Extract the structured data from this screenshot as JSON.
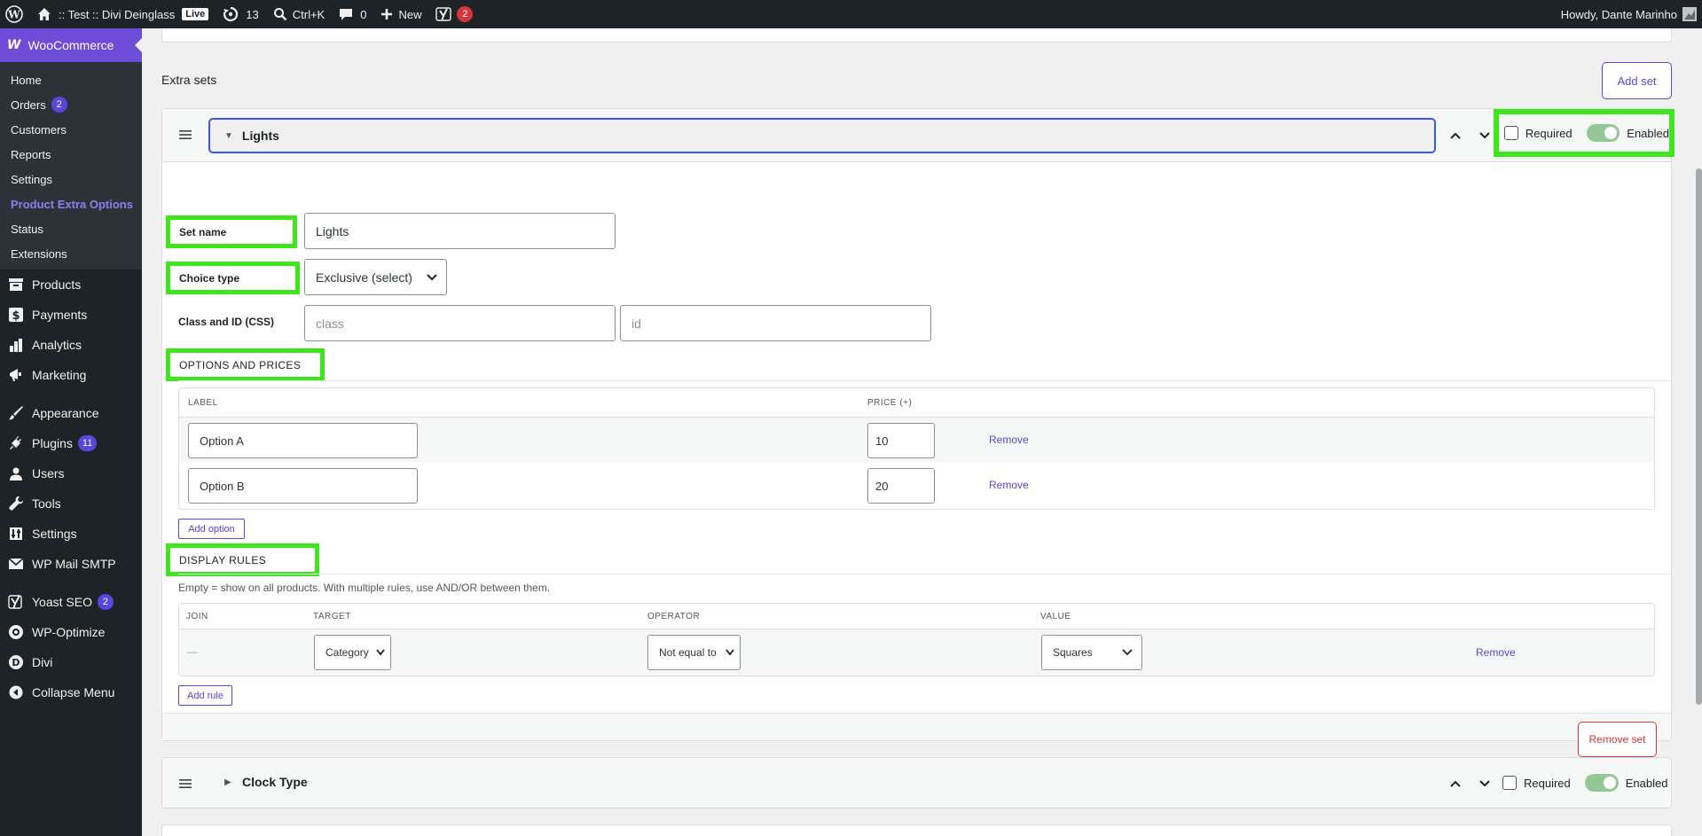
{
  "admin_bar": {
    "site_name": ":: Test :: Divi Deinglass",
    "live_badge": "Live",
    "updates_count": "13",
    "search_shortcut": "Ctrl+K",
    "comments_count": "0",
    "new_label": "New",
    "yoast_count": "2",
    "howdy": "Howdy, Dante Marinho"
  },
  "sidebar": {
    "woocommerce_label": "WooCommerce",
    "woo_submenu": [
      {
        "label": "Home"
      },
      {
        "label": "Orders",
        "count": "2"
      },
      {
        "label": "Customers"
      },
      {
        "label": "Reports"
      },
      {
        "label": "Settings"
      },
      {
        "label": "Product Extra Options"
      },
      {
        "label": "Status"
      },
      {
        "label": "Extensions"
      }
    ],
    "menu": {
      "products": "Products",
      "payments": "Payments",
      "analytics": "Analytics",
      "marketing": "Marketing",
      "appearance": "Appearance",
      "plugins": "Plugins",
      "plugins_count": "11",
      "users": "Users",
      "tools": "Tools",
      "settings": "Settings",
      "wp_mail_smtp": "WP Mail SMTP",
      "yoast_seo": "Yoast SEO",
      "yoast_count": "2",
      "wp_optimize": "WP-Optimize",
      "divi": "Divi",
      "collapse": "Collapse Menu"
    }
  },
  "main": {
    "extra_sets_title": "Extra sets",
    "add_set_label": "Add set",
    "set1": {
      "title": "Lights",
      "required_label": "Required",
      "enabled_label": "Enabled",
      "set_name_label": "Set name",
      "set_name_value": "Lights",
      "choice_type_label": "Choice type",
      "choice_type_value": "Exclusive (select)",
      "class_id_label": "Class and ID (CSS)",
      "class_placeholder": "class",
      "id_placeholder": "id",
      "options_heading": "OPTIONS AND PRICES",
      "col_label": "LABEL",
      "col_price": "PRICE (+)",
      "options": [
        {
          "label": "Option A",
          "price": "10",
          "remove": "Remove"
        },
        {
          "label": "Option B",
          "price": "20",
          "remove": "Remove"
        }
      ],
      "add_option_label": "Add option",
      "display_rules_heading": "DISPLAY RULES",
      "display_rules_help": "Empty = show on all products. With multiple rules, use AND/OR between them.",
      "rules_cols": {
        "join": "JOIN",
        "target": "TARGET",
        "operator": "OPERATOR",
        "value": "VALUE"
      },
      "rule": {
        "join": "—",
        "target": "Category",
        "operator": "Not equal to",
        "value": "Squares",
        "remove": "Remove"
      },
      "add_rule_label": "Add rule",
      "remove_set_label": "Remove set"
    },
    "set2": {
      "title": "Clock Type",
      "required_label": "Required",
      "enabled_label": "Enabled"
    }
  },
  "colors": {
    "accent": "#5b44e0",
    "highlight": "#3ee61c",
    "admin_bar": "#1d2327",
    "danger": "#d63638"
  }
}
